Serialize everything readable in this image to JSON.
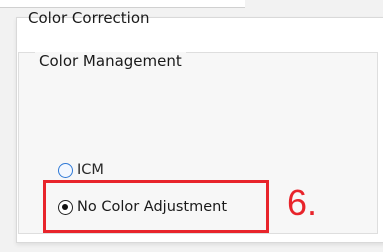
{
  "panel": {
    "title": "Color Correction",
    "group": {
      "legend": "Color Management",
      "options": [
        {
          "label": "ICM",
          "selected": false
        },
        {
          "label": "No Color Adjustment",
          "selected": true
        }
      ]
    }
  },
  "annotation": {
    "step": "6.",
    "color": "#e8242b"
  }
}
